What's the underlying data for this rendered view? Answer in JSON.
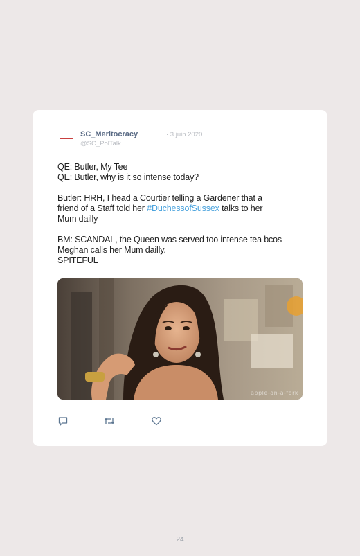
{
  "tweet": {
    "user_name": "SC_Meritocracy",
    "date": "· 3 juin 2020",
    "handle": "@SC_PolTalk",
    "lines": [
      "QE: Butler, My Tee",
      "QE: Butler, why is it so intense today?",
      "",
      "Butler: HRH, I head a Courtier telling a Gardener that a",
      "friend of a Staff told her ",
      "Mum dailly",
      "",
      "BM: SCANDAL, the Queen was served too intense tea bcos",
      "Meghan calls her Mum dailly.",
      "SPITEFUL"
    ],
    "hashtag": "#DuchessofSussex",
    "hashtag_suffix": " talks to her",
    "media_watermark": "apple-an-a-fork",
    "hashtag_color": "#4aa3dd",
    "name_color": "#5a6b85"
  },
  "actions": {
    "reply_icon": "reply-icon",
    "retweet_icon": "retweet-icon",
    "like_icon": "heart-icon"
  },
  "page": {
    "number": "24"
  }
}
